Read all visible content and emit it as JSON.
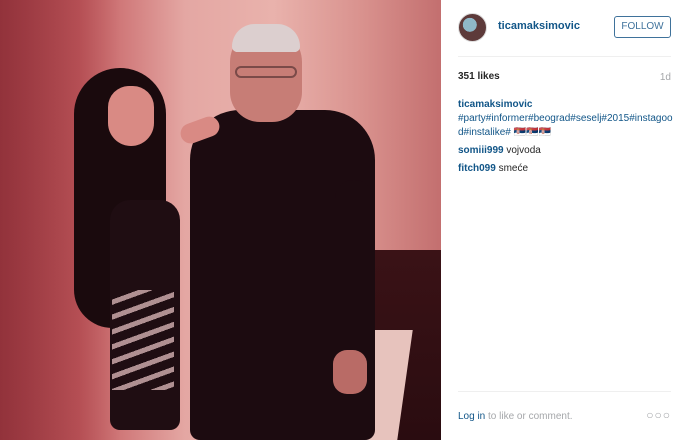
{
  "post": {
    "username": "ticamaksimovic",
    "follow_label": "FOLLOW",
    "likes": "351 likes",
    "time_ago": "1d"
  },
  "comments": [
    {
      "user": "ticamaksimovic",
      "text": "#party#informer#beograd#seselj#2015#instagood#instalike# 🇷🇸🇷🇸🇷🇸"
    },
    {
      "user": "somiii999",
      "text": "vojvoda"
    },
    {
      "user": "fitch099",
      "text": "smeće"
    }
  ],
  "footer": {
    "login_link": "Log in",
    "login_text": " to like or comment.",
    "more_label": "○○○"
  },
  "icons": {
    "more": "more-options-icon",
    "avatar": "profile-avatar"
  }
}
